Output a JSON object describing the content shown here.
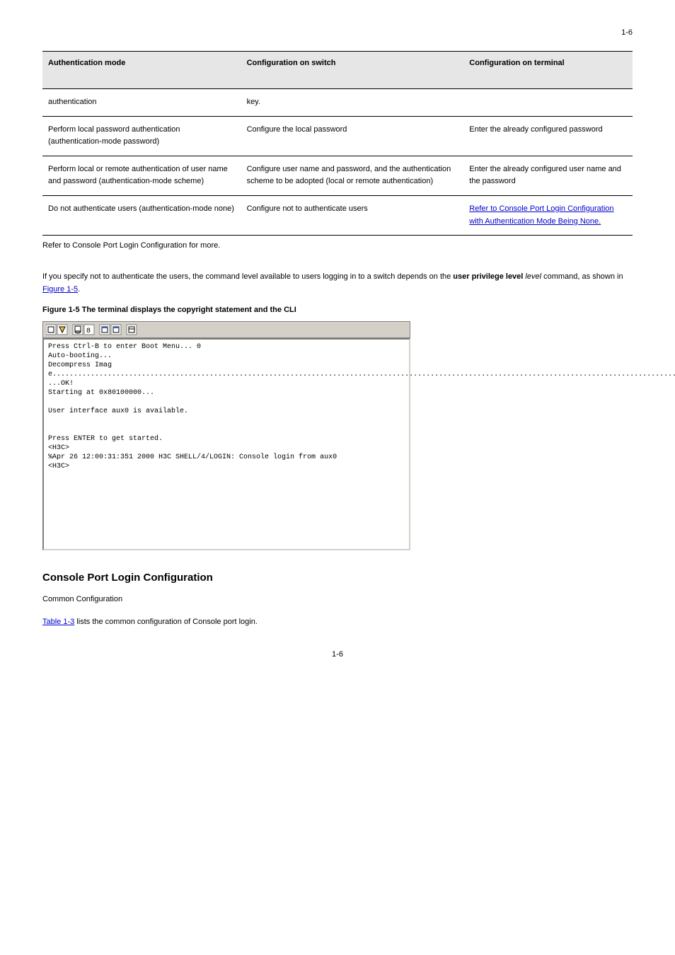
{
  "page_top_number": "1-6",
  "table": {
    "headers": [
      "Authentication mode",
      "Configuration on switch",
      "Configuration on terminal"
    ],
    "rows": [
      {
        "mode": "authentication",
        "switch": "key.",
        "terminal": ""
      },
      {
        "mode": "Perform local password authentication (authentication-mode password)",
        "switch": "Configure the local password",
        "terminal": "Enter the already configured password"
      },
      {
        "mode": "Perform local or remote authentication of user name and password (authentication-mode scheme)",
        "switch": "Configure user name and password, and the authentication scheme to be adopted (local or remote authentication)",
        "terminal": "Enter the already configured user name and the password"
      },
      {
        "mode": "Do not authenticate users (authentication-mode none)",
        "switch": "Configure not to authenticate users",
        "terminal": "Refer to Console Port Login Configuration with Authentication Mode Being None."
      }
    ]
  },
  "table_note": "Refer to Console Port Login Configuration for more.",
  "para1_before": "If you specify not to authenticate the users, the command level available to users logging in to a switch depends on the ",
  "para1_bold1": "user privilege level",
  "para1_italic": " level ",
  "para1_after": "command, as shown in ",
  "para1_link": "Figure 1-5",
  "para1_period": ".",
  "figure_caption": "Figure 1-5 The terminal displays the copyright statement and the CLI",
  "terminal": {
    "line1": "Press Ctrl-B to enter Boot Menu... 0",
    "line2": "Auto-booting...",
    "line3": "Decompress Image.........................................................................................................................................................................................................................................................................................................................................................................................................................................................................................................................",
    "line4": "...OK!",
    "line5": "Starting at 0x80100000...",
    "line6": "",
    "line7": "User interface aux0 is available.",
    "line8": "",
    "line9": "",
    "line10": "Press ENTER to get started.",
    "line11": "<H3C>",
    "line12": "%Apr 26 12:00:31:351 2000 H3C SHELL/4/LOGIN: Console login from aux0",
    "line13": "<H3C>"
  },
  "section_heading": "Console Port Login Configuration",
  "subheading": "Common Configuration",
  "para2_before": "Table 1-3",
  "para2_after": " lists the common configuration of Console port login.",
  "page_bottom_number": "1-6"
}
